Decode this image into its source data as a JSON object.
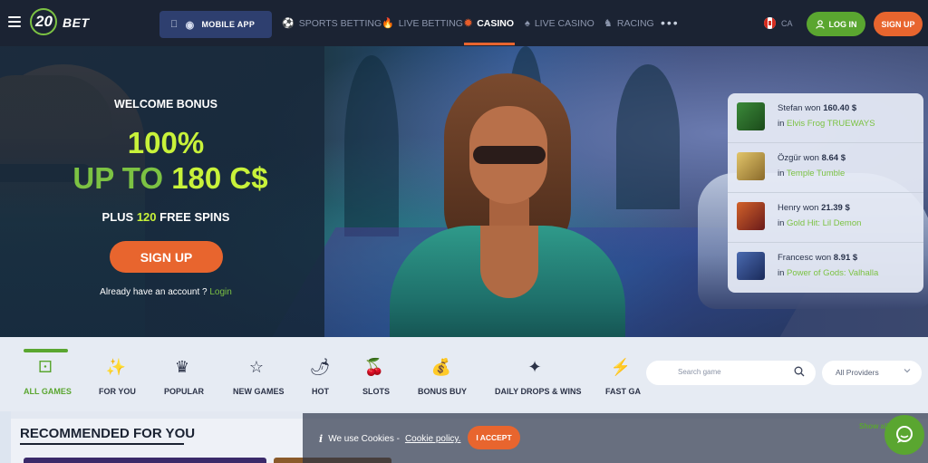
{
  "header": {
    "logo": "20BET",
    "logo_number": "20",
    "logo_word": "BET",
    "mobile_app": "MOBILE APP",
    "nav": [
      {
        "label": "SPORTS BETTING",
        "icon": "ball-icon"
      },
      {
        "label": "LIVE BETTING",
        "icon": "flame-icon"
      },
      {
        "label": "CASINO",
        "icon": "roulette-icon",
        "active": true
      },
      {
        "label": "LIVE CASINO",
        "icon": "card-icon"
      },
      {
        "label": "RACING",
        "icon": "horse-icon"
      }
    ],
    "more": "•••",
    "lang": "CA",
    "login": "LOG IN",
    "signup": "SIGN UP"
  },
  "hero": {
    "welcome": "WELCOME BONUS",
    "percent": "100%",
    "upto_prefix": "UP TO",
    "upto_amount": "180 C$",
    "spins_prefix": "PLUS",
    "spins_number": "120",
    "spins_suffix": "FREE SPINS",
    "signup": "SIGN UP",
    "account_text": "Already have an account ?",
    "login_link": "Login"
  },
  "winners": [
    {
      "name": "Stefan",
      "won": "won",
      "amount": "160.40 $",
      "in": "in",
      "game": "Elvis Frog TRUEWAYS",
      "color": "#3b8a3a"
    },
    {
      "name": "Özgür",
      "won": "won",
      "amount": "8.64 $",
      "in": "in",
      "game": "Temple Tumble",
      "color": "#c9a34a"
    },
    {
      "name": "Henry",
      "won": "won",
      "amount": "21.39 $",
      "in": "in",
      "game": "Gold Hit: Lil Demon",
      "color": "#b8442a"
    },
    {
      "name": "Francesc",
      "won": "won",
      "amount": "8.91 $",
      "in": "in",
      "game": "Power of Gods: Valhalla",
      "color": "#3a5a9a"
    }
  ],
  "categories": [
    {
      "label": "ALL GAMES",
      "icon": "dice-icon",
      "active": true
    },
    {
      "label": "FOR YOU",
      "icon": "sparkle-icon"
    },
    {
      "label": "POPULAR",
      "icon": "crown-icon"
    },
    {
      "label": "NEW GAMES",
      "icon": "star-icon"
    },
    {
      "label": "HOT",
      "icon": "chili-icon"
    },
    {
      "label": "SLOTS",
      "icon": "cherry-icon"
    },
    {
      "label": "BONUS BUY",
      "icon": "money-bag-icon"
    },
    {
      "label": "DAILY DROPS & WINS",
      "icon": "drops-wins-icon"
    },
    {
      "label": "FAST GA",
      "icon": "lightning-icon"
    }
  ],
  "search": {
    "placeholder": "Search game"
  },
  "providers": {
    "value": "All Providers"
  },
  "recommended": {
    "title": "RECOMMENDED FOR YOU",
    "show_all": "Show all"
  },
  "cookie": {
    "info": "i",
    "text": "We use Cookies -",
    "policy": "Cookie policy.",
    "accept": "I ACCEPT"
  },
  "colors": {
    "brand_green": "#5aa630",
    "accent_orange": "#e8652e",
    "header_bg": "#1b2333",
    "lime": "#c8f23a"
  }
}
